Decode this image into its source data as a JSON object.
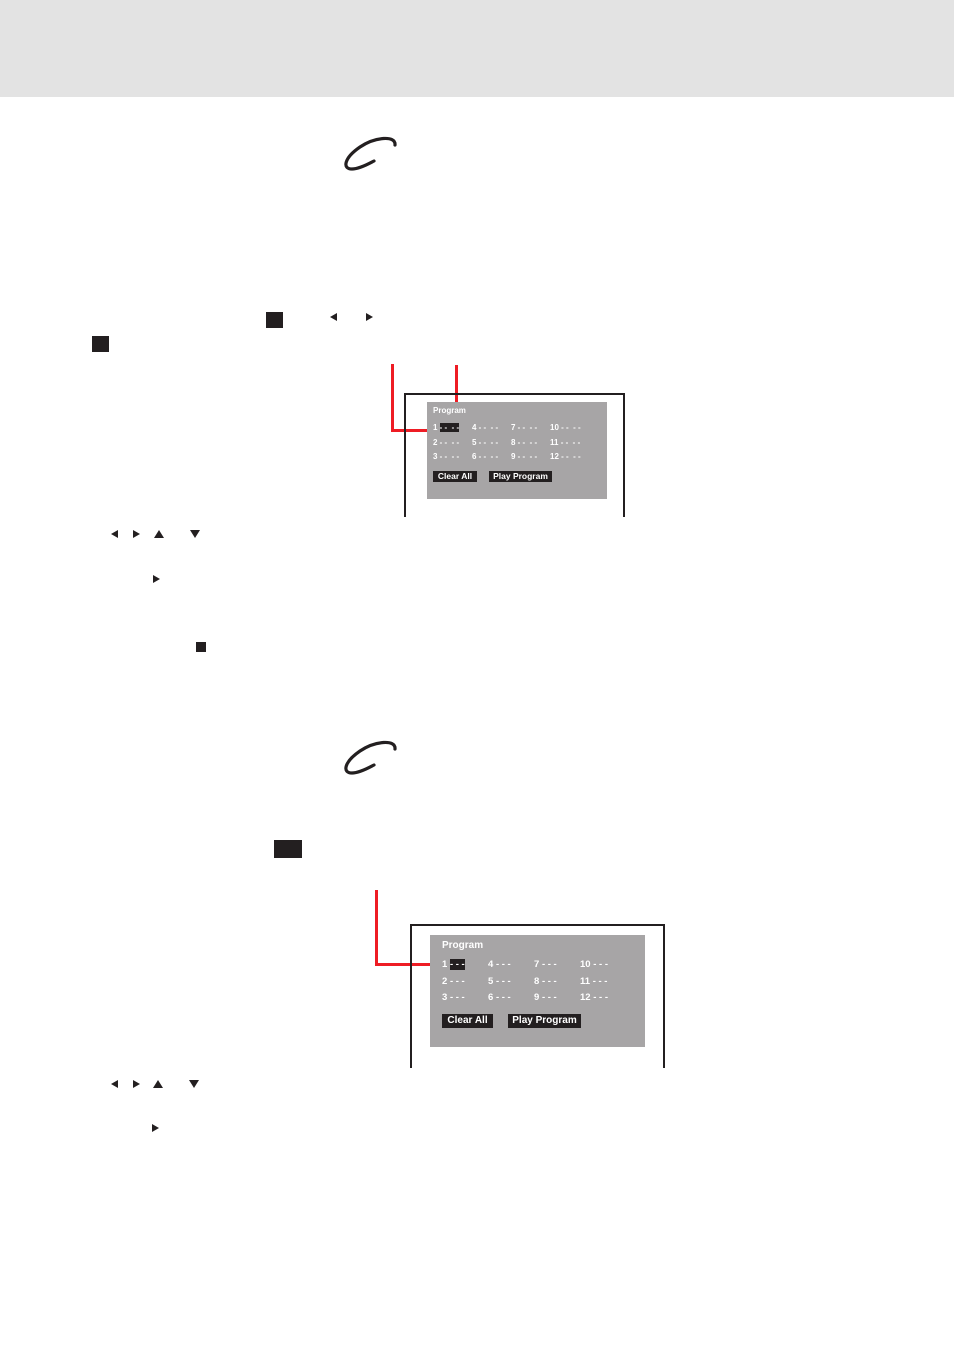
{
  "page": {
    "header_band_color": "#e3e3e3",
    "accent_callout_color": "#ee1c24"
  },
  "section1": {
    "logo_glyph": "C",
    "inline_icons": [
      "stop-square-icon",
      "left-arrow-icon",
      "right-arrow-icon",
      "stop-square-icon"
    ],
    "nav_icons": [
      "left-arrow-icon",
      "right-arrow-icon",
      "up-arrow-icon",
      "down-arrow-icon"
    ],
    "play_icon": "play-icon",
    "stop_icon": "stop-icon",
    "menu": {
      "title": "Program",
      "slots": [
        {
          "num": "1",
          "value": "- -  - -",
          "selected": true
        },
        {
          "num": "2",
          "value": "- -  - -"
        },
        {
          "num": "3",
          "value": "- -  - -"
        },
        {
          "num": "4",
          "value": "- -  - -"
        },
        {
          "num": "5",
          "value": "- -  - -"
        },
        {
          "num": "6",
          "value": "- -  - -"
        },
        {
          "num": "7",
          "value": "- -  - -"
        },
        {
          "num": "8",
          "value": "- -  - -"
        },
        {
          "num": "9",
          "value": "- -  - -"
        },
        {
          "num": "10",
          "value": "- -  - -"
        },
        {
          "num": "11",
          "value": "- -  - -"
        },
        {
          "num": "12",
          "value": "- -  - -"
        }
      ],
      "buttons": {
        "clear_all": "Clear All",
        "play_program": "Play Program"
      }
    }
  },
  "section2": {
    "logo_glyph": "C",
    "inline_icons": [
      "button-rectangle-icon"
    ],
    "nav_icons": [
      "left-arrow-icon",
      "right-arrow-icon",
      "up-arrow-icon",
      "down-arrow-icon"
    ],
    "play_icon": "play-icon",
    "menu": {
      "title": "Program",
      "slots": [
        {
          "num": "1",
          "value": "- - -",
          "selected": true
        },
        {
          "num": "2",
          "value": "- - -"
        },
        {
          "num": "3",
          "value": "- - -"
        },
        {
          "num": "4",
          "value": "- - -"
        },
        {
          "num": "5",
          "value": "- - -"
        },
        {
          "num": "6",
          "value": "- - -"
        },
        {
          "num": "7",
          "value": "- - -"
        },
        {
          "num": "8",
          "value": "- - -"
        },
        {
          "num": "9",
          "value": "- - -"
        },
        {
          "num": "10",
          "value": "- - -"
        },
        {
          "num": "11",
          "value": "- - -"
        },
        {
          "num": "12",
          "value": "- - -"
        }
      ],
      "buttons": {
        "clear_all": "Clear All",
        "play_program": "Play Program"
      }
    }
  }
}
